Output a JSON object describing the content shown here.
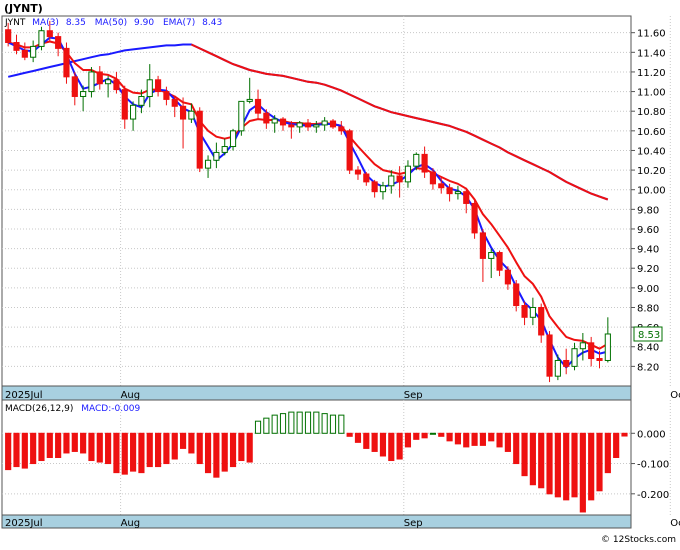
{
  "title": "(JYNT)",
  "legend": {
    "symbol": "JYNT",
    "ma_short": "MA(3)",
    "ma_short_value": "8.35",
    "ma_long": "MA(50)",
    "ma_long_value": "9.90",
    "ema": "EMA(7)",
    "ema_value": "8.43"
  },
  "macd_legend": {
    "label": "MACD(26,12,9)",
    "value_label": "MACD:-0.009"
  },
  "last_price_label": "8.53",
  "watermark": "© 12Stocks.com",
  "colors": {
    "up": "#007000",
    "down": "#ee1111",
    "ma_short": "#1a1aff",
    "ma_long": "#1a1aff",
    "ema": "#ee1111",
    "axis_band": "#a8d0e0",
    "grid": "#c8c8c8"
  },
  "chart_data": [
    {
      "type": "candlestick",
      "y_ticks": [
        "11.60",
        "11.40",
        "11.20",
        "11.00",
        "10.80",
        "10.60",
        "10.40",
        "10.20",
        "10.00",
        "9.80",
        "9.60",
        "9.40",
        "9.20",
        "9.00",
        "8.80",
        "8.60",
        "8.40",
        "8.20"
      ],
      "y_tick_values": [
        11.6,
        11.4,
        11.2,
        11.0,
        10.8,
        10.6,
        10.4,
        10.2,
        10.0,
        9.8,
        9.6,
        9.4,
        9.2,
        9.0,
        8.8,
        8.6,
        8.4,
        8.2
      ],
      "ylim": [
        8.0,
        11.77
      ],
      "x_labels": [
        "2025Jul",
        "Aug",
        "Sep",
        "Oct"
      ],
      "x_label_index": [
        0,
        14,
        48,
        80
      ],
      "ohlc": [
        [
          11.63,
          11.7,
          11.46,
          11.5
        ],
        [
          11.5,
          11.58,
          11.38,
          11.42
        ],
        [
          11.42,
          11.5,
          11.32,
          11.35
        ],
        [
          11.35,
          11.52,
          11.3,
          11.46
        ],
        [
          11.46,
          11.66,
          11.42,
          11.62
        ],
        [
          11.62,
          11.72,
          11.52,
          11.56
        ],
        [
          11.56,
          11.6,
          11.36,
          11.44
        ],
        [
          11.44,
          11.5,
          11.08,
          11.15
        ],
        [
          11.15,
          11.2,
          10.86,
          10.95
        ],
        [
          10.95,
          11.06,
          10.8,
          11.0
        ],
        [
          11.0,
          11.25,
          10.94,
          11.2
        ],
        [
          11.2,
          11.26,
          11.02,
          11.08
        ],
        [
          11.08,
          11.16,
          10.94,
          11.12
        ],
        [
          11.12,
          11.2,
          10.98,
          11.02
        ],
        [
          11.02,
          11.06,
          10.62,
          10.72
        ],
        [
          10.72,
          10.9,
          10.6,
          10.86
        ],
        [
          10.86,
          11.02,
          10.78,
          10.95
        ],
        [
          10.95,
          11.28,
          10.84,
          11.12
        ],
        [
          11.12,
          11.16,
          10.95,
          11.0
        ],
        [
          11.0,
          11.05,
          10.86,
          10.92
        ],
        [
          10.92,
          10.96,
          10.74,
          10.85
        ],
        [
          10.85,
          10.94,
          10.42,
          10.72
        ],
        [
          10.72,
          10.88,
          10.68,
          10.8
        ],
        [
          10.8,
          10.84,
          10.18,
          10.22
        ],
        [
          10.22,
          10.35,
          10.12,
          10.3
        ],
        [
          10.3,
          10.48,
          10.22,
          10.38
        ],
        [
          10.38,
          10.52,
          10.35,
          10.44
        ],
        [
          10.44,
          10.62,
          10.4,
          10.6
        ],
        [
          10.6,
          10.84,
          10.55,
          10.9
        ],
        [
          10.9,
          11.14,
          10.88,
          10.92
        ],
        [
          10.92,
          11.02,
          10.72,
          10.78
        ],
        [
          10.78,
          10.82,
          10.62,
          10.68
        ],
        [
          10.68,
          10.76,
          10.58,
          10.72
        ],
        [
          10.72,
          10.74,
          10.6,
          10.66
        ],
        [
          10.66,
          10.7,
          10.52,
          10.64
        ],
        [
          10.64,
          10.7,
          10.58,
          10.68
        ],
        [
          10.68,
          10.72,
          10.6,
          10.64
        ],
        [
          10.64,
          10.7,
          10.58,
          10.66
        ],
        [
          10.66,
          10.74,
          10.6,
          10.7
        ],
        [
          10.7,
          10.72,
          10.62,
          10.64
        ],
        [
          10.64,
          10.7,
          10.56,
          10.6
        ],
        [
          10.6,
          10.62,
          10.16,
          10.2
        ],
        [
          10.2,
          10.24,
          10.1,
          10.16
        ],
        [
          10.16,
          10.18,
          10.04,
          10.08
        ],
        [
          10.08,
          10.1,
          9.92,
          9.98
        ],
        [
          9.98,
          10.08,
          9.9,
          10.04
        ],
        [
          10.04,
          10.2,
          9.96,
          10.14
        ],
        [
          10.14,
          10.24,
          9.92,
          10.08
        ],
        [
          10.08,
          10.3,
          10.02,
          10.24
        ],
        [
          10.24,
          10.38,
          10.2,
          10.36
        ],
        [
          10.36,
          10.44,
          10.12,
          10.18
        ],
        [
          10.18,
          10.22,
          10.0,
          10.06
        ],
        [
          10.06,
          10.12,
          9.96,
          10.02
        ],
        [
          10.02,
          10.06,
          9.88,
          9.96
        ],
        [
          9.96,
          10.04,
          9.9,
          9.98
        ],
        [
          9.98,
          10.02,
          9.76,
          9.86
        ],
        [
          9.86,
          9.9,
          9.5,
          9.56
        ],
        [
          9.56,
          9.6,
          9.06,
          9.3
        ],
        [
          9.3,
          9.4,
          9.1,
          9.36
        ],
        [
          9.36,
          9.38,
          9.12,
          9.18
        ],
        [
          9.18,
          9.22,
          8.98,
          9.04
        ],
        [
          9.04,
          9.08,
          8.76,
          8.82
        ],
        [
          8.82,
          8.86,
          8.62,
          8.7
        ],
        [
          8.7,
          8.9,
          8.62,
          8.8
        ],
        [
          8.8,
          8.84,
          8.44,
          8.52
        ],
        [
          8.52,
          8.56,
          8.04,
          8.1
        ],
        [
          8.1,
          8.32,
          8.06,
          8.26
        ],
        [
          8.26,
          8.38,
          8.12,
          8.2
        ],
        [
          8.2,
          8.44,
          8.16,
          8.38
        ],
        [
          8.38,
          8.54,
          8.26,
          8.44
        ],
        [
          8.44,
          8.5,
          8.2,
          8.28
        ],
        [
          8.28,
          8.36,
          8.18,
          8.26
        ],
        [
          8.26,
          8.7,
          8.24,
          8.53
        ]
      ],
      "ma3": [
        11.5,
        11.46,
        11.42,
        11.41,
        11.48,
        11.55,
        11.54,
        11.38,
        11.18,
        11.03,
        11.05,
        11.09,
        11.13,
        11.07,
        10.95,
        10.87,
        10.84,
        10.98,
        11.02,
        11.01,
        10.92,
        10.83,
        10.79,
        10.58,
        10.44,
        10.3,
        10.37,
        10.47,
        10.64,
        10.81,
        10.87,
        10.79,
        10.73,
        10.69,
        10.67,
        10.66,
        10.65,
        10.66,
        10.67,
        10.67,
        10.65,
        10.48,
        10.32,
        10.15,
        10.07,
        10.03,
        10.05,
        10.09,
        10.15,
        10.23,
        10.26,
        10.2,
        10.09,
        10.01,
        9.99,
        9.93,
        9.8,
        9.57,
        9.41,
        9.28,
        9.19,
        9.01,
        8.85,
        8.77,
        8.67,
        8.47,
        8.29,
        8.19,
        8.28,
        8.34,
        8.37,
        8.33,
        8.35
      ],
      "ema7": [
        11.5,
        11.48,
        11.45,
        11.45,
        11.49,
        11.51,
        11.49,
        11.4,
        11.29,
        11.22,
        11.22,
        11.18,
        11.17,
        11.13,
        11.03,
        10.99,
        10.98,
        11.02,
        11.02,
        10.99,
        10.95,
        10.89,
        10.87,
        10.7,
        10.6,
        10.54,
        10.52,
        10.54,
        10.63,
        10.7,
        10.72,
        10.71,
        10.71,
        10.7,
        10.68,
        10.68,
        10.67,
        10.67,
        10.68,
        10.67,
        10.65,
        10.54,
        10.44,
        10.35,
        10.26,
        10.2,
        10.18,
        10.16,
        10.18,
        10.22,
        10.21,
        10.17,
        10.13,
        10.09,
        10.06,
        10.01,
        9.9,
        9.75,
        9.65,
        9.53,
        9.41,
        9.26,
        9.12,
        9.04,
        8.91,
        8.71,
        8.6,
        8.5,
        8.47,
        8.46,
        8.42,
        8.38,
        8.43
      ],
      "ma50": [
        11.15,
        11.17,
        11.19,
        11.21,
        11.23,
        11.25,
        11.27,
        11.29,
        11.31,
        11.33,
        11.35,
        11.37,
        11.38,
        11.4,
        11.42,
        11.43,
        11.44,
        11.45,
        11.46,
        11.47,
        11.47,
        11.48,
        11.48,
        11.44,
        11.4,
        11.36,
        11.32,
        11.28,
        11.25,
        11.22,
        11.2,
        11.18,
        11.17,
        11.16,
        11.14,
        11.12,
        11.1,
        11.09,
        11.07,
        11.04,
        11.01,
        10.97,
        10.93,
        10.89,
        10.85,
        10.82,
        10.79,
        10.77,
        10.75,
        10.73,
        10.71,
        10.69,
        10.67,
        10.65,
        10.62,
        10.59,
        10.55,
        10.51,
        10.47,
        10.43,
        10.38,
        10.34,
        10.3,
        10.26,
        10.22,
        10.18,
        10.13,
        10.08,
        10.04,
        10.0,
        9.96,
        9.93,
        9.9
      ],
      "ma50_start_index": 0
    },
    {
      "type": "bar",
      "name": "MACD(26,12,9)",
      "y_ticks": [
        "0.000",
        "-0.100",
        "-0.200"
      ],
      "y_tick_values": [
        0.0,
        -0.1,
        -0.2
      ],
      "ylim": [
        -0.27,
        0.11
      ],
      "values": [
        -0.12,
        -0.11,
        -0.115,
        -0.1,
        -0.09,
        -0.08,
        -0.08,
        -0.065,
        -0.06,
        -0.065,
        -0.09,
        -0.095,
        -0.1,
        -0.13,
        -0.135,
        -0.125,
        -0.13,
        -0.11,
        -0.11,
        -0.1,
        -0.085,
        -0.05,
        -0.065,
        -0.1,
        -0.13,
        -0.145,
        -0.125,
        -0.11,
        -0.09,
        -0.095,
        0.04,
        0.05,
        0.06,
        0.065,
        0.07,
        0.07,
        0.07,
        0.07,
        0.065,
        0.06,
        0.06,
        -0.01,
        -0.03,
        -0.05,
        -0.06,
        -0.075,
        -0.09,
        -0.085,
        -0.045,
        -0.02,
        -0.015,
        0.0,
        -0.01,
        -0.025,
        -0.035,
        -0.045,
        -0.04,
        -0.04,
        -0.025,
        -0.045,
        -0.06,
        -0.1,
        -0.14,
        -0.17,
        -0.18,
        -0.2,
        -0.21,
        -0.22,
        -0.21,
        -0.26,
        -0.22,
        -0.19,
        -0.13,
        -0.08,
        -0.009
      ]
    }
  ]
}
